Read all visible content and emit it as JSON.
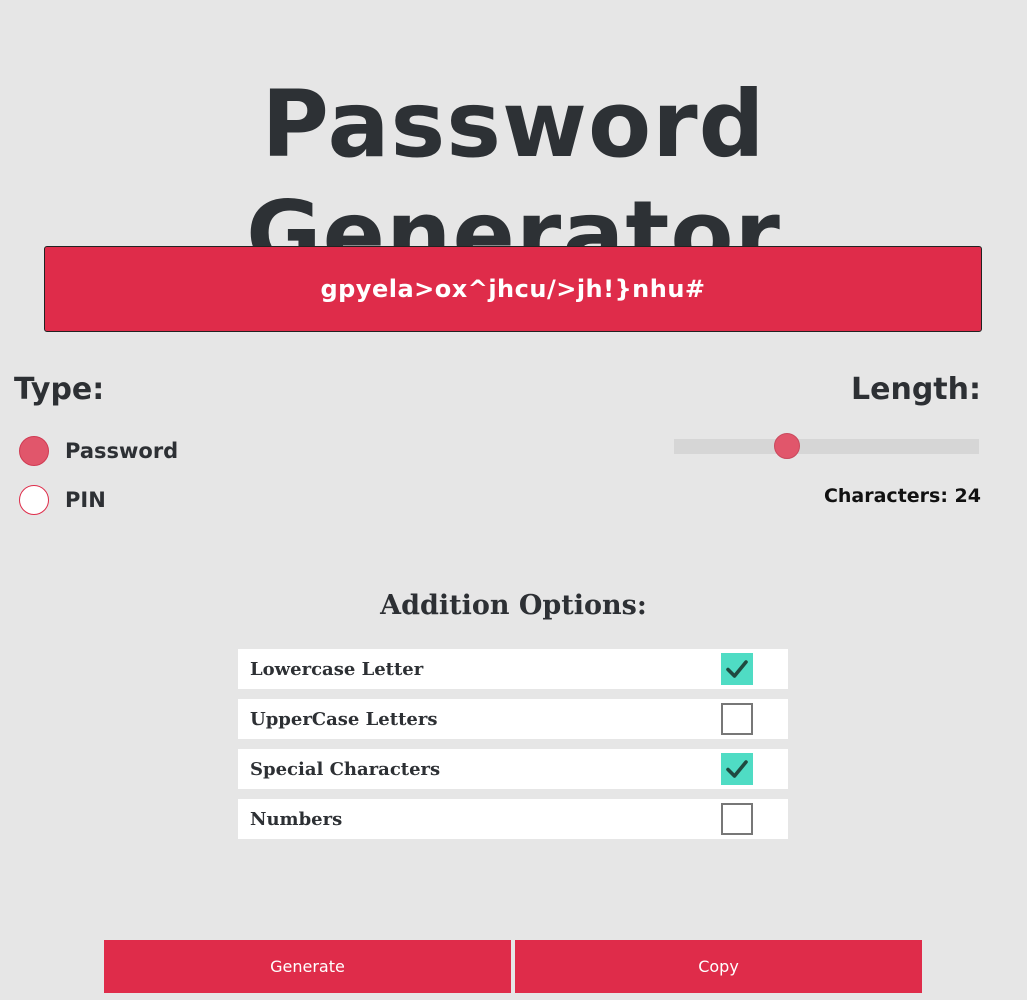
{
  "header": {
    "title": "Password Generator"
  },
  "output": {
    "password": "gpyela>ox^jhcu/>jh!}nhu#"
  },
  "type": {
    "label": "Type:",
    "options": [
      {
        "label": "Password",
        "selected": true
      },
      {
        "label": "PIN",
        "selected": false
      }
    ]
  },
  "length": {
    "label": "Length:",
    "value": 24,
    "slider_fraction": 0.37,
    "characters_text": "Characters: 24"
  },
  "addition_options": {
    "title": "Addition Options:",
    "items": [
      {
        "label": "Lowercase Letter",
        "checked": true
      },
      {
        "label": "UpperCase Letters",
        "checked": false
      },
      {
        "label": "Special Characters",
        "checked": true
      },
      {
        "label": "Numbers",
        "checked": false
      }
    ]
  },
  "actions": {
    "generate_label": "Generate",
    "copy_label": "Copy"
  },
  "colors": {
    "accent": "#df2c4a",
    "radio_fill": "#e1566b",
    "check_fill": "#4fdcc4",
    "background": "#e6e6e6",
    "text": "#2d3034"
  },
  "icons": {
    "check": "check-icon"
  }
}
